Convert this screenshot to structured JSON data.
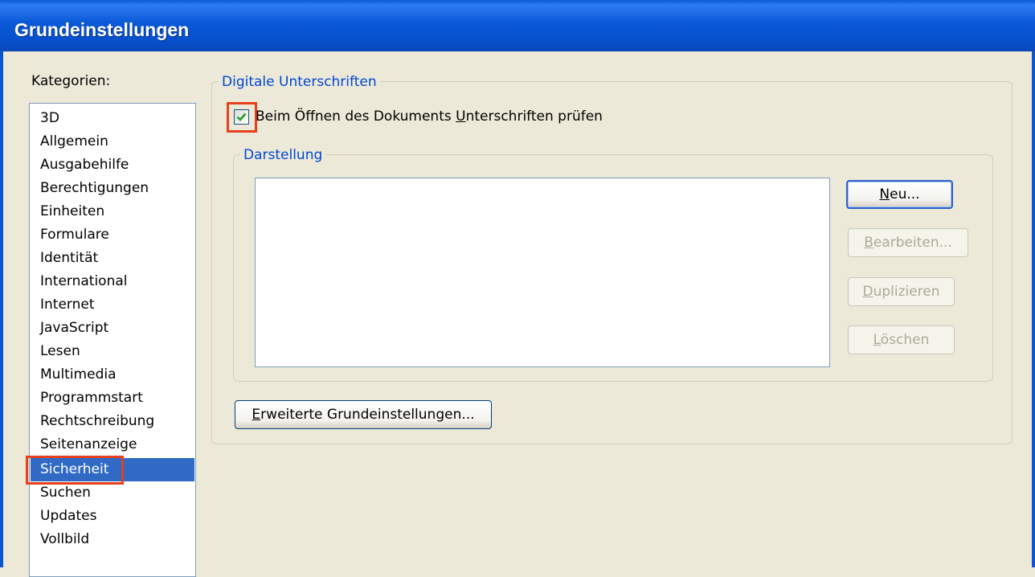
{
  "window": {
    "title": "Grundeinstellungen"
  },
  "categories": {
    "label": "Kategorien:",
    "items": [
      {
        "label": "3D"
      },
      {
        "label": "Allgemein"
      },
      {
        "label": "Ausgabehilfe"
      },
      {
        "label": "Berechtigungen"
      },
      {
        "label": "Einheiten"
      },
      {
        "label": "Formulare"
      },
      {
        "label": "Identität"
      },
      {
        "label": "International"
      },
      {
        "label": "Internet"
      },
      {
        "label": "JavaScript"
      },
      {
        "label": "Lesen"
      },
      {
        "label": "Multimedia"
      },
      {
        "label": "Programmstart"
      },
      {
        "label": "Rechtschreibung"
      },
      {
        "label": "Seitenanzeige"
      },
      {
        "label": "Sicherheit"
      },
      {
        "label": "Suchen"
      },
      {
        "label": "Updates"
      },
      {
        "label": "Vollbild"
      }
    ],
    "selected": "Sicherheit"
  },
  "digital_signatures": {
    "legend": "Digitale Unterschriften",
    "verify_checkbox": {
      "label_pre": "Beim Öffnen des Dokuments ",
      "label_accel": "U",
      "label_post": "nterschriften prüfen",
      "checked": true
    },
    "appearance": {
      "legend": "Darstellung",
      "buttons": {
        "new": {
          "accel": "N",
          "rest": "eu...",
          "enabled": true
        },
        "edit": {
          "accel": "B",
          "rest": "earbeiten...",
          "enabled": false
        },
        "duplicate": {
          "accel": "D",
          "rest": "uplizieren",
          "enabled": false
        },
        "delete": {
          "accel": "L",
          "rest": "öschen",
          "enabled": false
        }
      }
    },
    "advanced_button": {
      "accel": "E",
      "rest": "rweiterte Grundeinstellungen..."
    }
  },
  "colors": {
    "titlebar": "#0a58d8",
    "dialog_bg": "#ece9d8",
    "selection": "#316ac5",
    "group_legend": "#0046d5",
    "highlight": "#e8401c"
  }
}
